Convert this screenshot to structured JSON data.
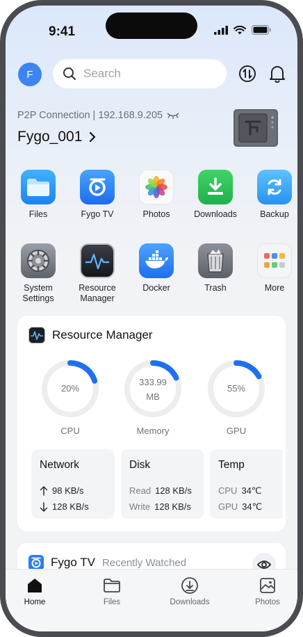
{
  "status": {
    "time": "9:41"
  },
  "header": {
    "avatar_letter": "F",
    "search_placeholder": "Search"
  },
  "connection": {
    "label": "P2P Connection | 192.168.9.205",
    "device_name": "Fygo_001"
  },
  "apps": [
    {
      "label": "Files"
    },
    {
      "label": "Fygo TV"
    },
    {
      "label": "Photos"
    },
    {
      "label": "Downloads"
    },
    {
      "label": "Backup"
    },
    {
      "label_line1": "System",
      "label_line2": "Settings"
    },
    {
      "label_line1": "Resource",
      "label_line2": "Manager"
    },
    {
      "label": "Docker"
    },
    {
      "label": "Trash"
    },
    {
      "label": "More"
    }
  ],
  "resource_manager": {
    "title": "Resource Manager",
    "gauges": [
      {
        "name": "CPU",
        "value_line1": "20%",
        "value_line2": "",
        "fraction": 0.2,
        "color": "#1f6ff2"
      },
      {
        "name": "Memory",
        "value_line1": "333.99",
        "value_line2": "MB",
        "fraction": 0.18,
        "color": "#1f6ff2"
      },
      {
        "name": "GPU",
        "value_line1": "55%",
        "value_line2": "",
        "fraction": 0.17,
        "color": "#1f6ff2"
      }
    ],
    "network": {
      "title": "Network",
      "up": "98 KB/s",
      "down": "128 KB/s"
    },
    "disk": {
      "title": "Disk",
      "read_label": "Read",
      "read_value": "128 KB/s",
      "write_label": "Write",
      "write_value": "128 KB/s"
    },
    "temp": {
      "title": "Temp",
      "cpu_label": "CPU",
      "cpu_value": "34℃",
      "gpu_label": "GPU",
      "gpu_value": "34℃"
    }
  },
  "fygo_tv": {
    "title": "Fygo TV",
    "subtitle": "Recently Watched"
  },
  "tabs": [
    {
      "label": "Home"
    },
    {
      "label": "Files"
    },
    {
      "label": "Downloads"
    },
    {
      "label": "Photos"
    }
  ],
  "colors": {
    "accent": "#3d84f1",
    "gauge_track": "#ededed",
    "gauge_fill": "#1f6ff2"
  }
}
